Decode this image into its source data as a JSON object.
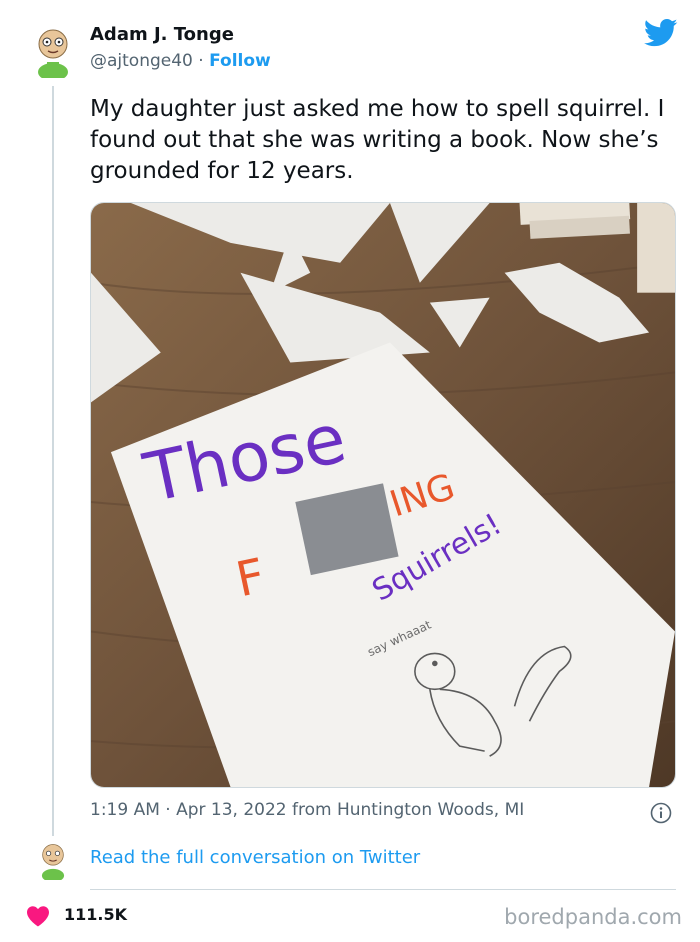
{
  "tweet": {
    "display_name": "Adam J. Tonge",
    "handle": "@ajtonge40",
    "separator": " · ",
    "follow_label": "Follow",
    "text": "My daughter just asked me how to spell squirrel. I found out that she was writing a book. Now she’s grounded for 12 years.",
    "timestamp": "1:19 AM · Apr 13, 2022 from Huntington Woods, MI",
    "read_more": "Read the full conversation on Twitter",
    "likes": "111.5K"
  },
  "photo": {
    "line1": "Those",
    "line2_left": "F",
    "line2_right": "ING",
    "line3": "Squirrels!",
    "speech": "say whaaat"
  },
  "footer": {
    "watermark": "boredpanda.com"
  },
  "icons": {
    "avatar": "cartoon-avatar-icon",
    "brand": "twitter-bird-icon",
    "info": "info-icon",
    "like": "heart-icon"
  },
  "colors": {
    "link": "#1d9bf0",
    "text": "#0f1419",
    "secondary": "#536471",
    "heart": "#f91880",
    "purple_marker": "#6a2fc2",
    "orange_marker": "#e8582c"
  }
}
